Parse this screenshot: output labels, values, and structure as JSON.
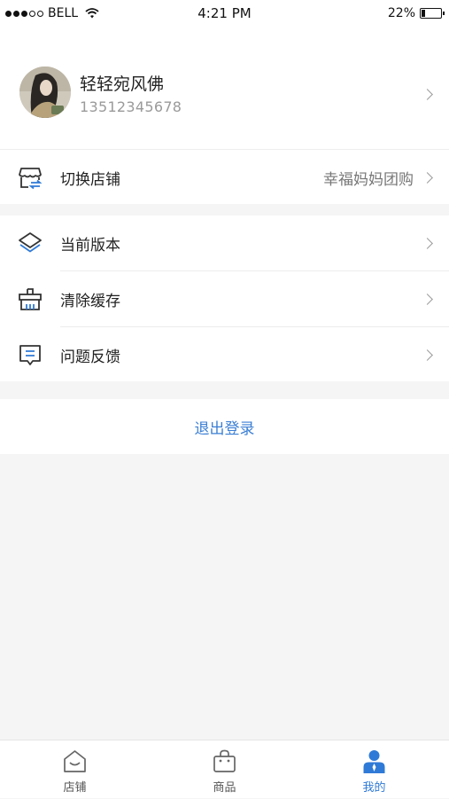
{
  "status_bar": {
    "carrier": "BELL",
    "time": "4:21 PM",
    "battery": "22%",
    "battery_level": 0.22
  },
  "profile": {
    "name": "轻轻宛风佛",
    "phone": "13512345678"
  },
  "store": {
    "label": "切换店铺",
    "value": "幸福妈妈团购",
    "icon": "store-switch-icon"
  },
  "menu": [
    {
      "label": "当前版本",
      "icon": "layers-icon"
    },
    {
      "label": "清除缓存",
      "icon": "broom-icon"
    },
    {
      "label": "问题反馈",
      "icon": "feedback-icon"
    }
  ],
  "logout_label": "退出登录",
  "tabs": [
    {
      "label": "店铺",
      "icon": "shop-icon"
    },
    {
      "label": "商品",
      "icon": "bag-icon"
    },
    {
      "label": "我的",
      "icon": "user-icon"
    }
  ],
  "colors": {
    "accent": "#2f7ad6",
    "logout": "#3b7fd4",
    "background": "#f5f5f5"
  }
}
